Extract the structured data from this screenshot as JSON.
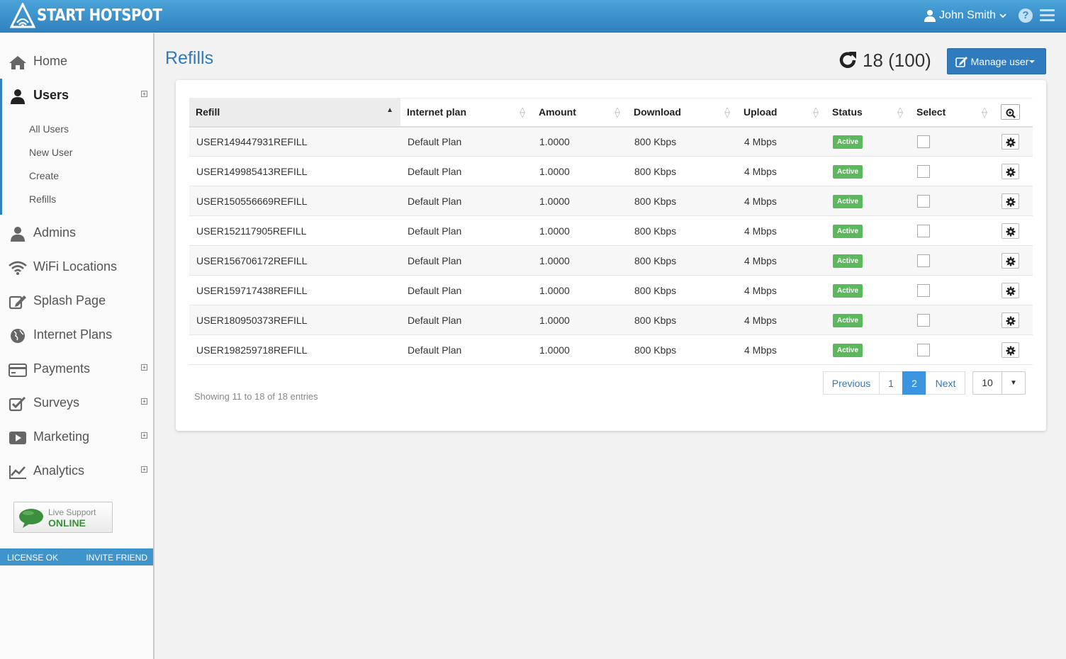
{
  "header": {
    "brand": "START HOTSPOT",
    "user_name": "John Smith",
    "help_glyph": "?"
  },
  "sidebar": {
    "items": [
      {
        "label": "Home",
        "icon": "home-icon"
      },
      {
        "label": "Users",
        "icon": "user-icon",
        "active": true,
        "expandable": true
      },
      {
        "label": "Admins",
        "icon": "admins-icon"
      },
      {
        "label": "WiFi Locations",
        "icon": "wifi-icon"
      },
      {
        "label": "Splash Page",
        "icon": "edit-icon"
      },
      {
        "label": "Internet Plans",
        "icon": "globe-icon"
      },
      {
        "label": "Payments",
        "icon": "credit-card-icon",
        "expandable": true
      },
      {
        "label": "Surveys",
        "icon": "check-square-icon",
        "expandable": true
      },
      {
        "label": "Marketing",
        "icon": "play-icon",
        "expandable": true
      },
      {
        "label": "Analytics",
        "icon": "chart-icon",
        "expandable": true
      }
    ],
    "sub_items": [
      "All Users",
      "New User",
      "Create",
      "Refills"
    ],
    "live_support": {
      "line1": "Live Support",
      "line2": "ONLINE"
    },
    "license": "LICENSE OK",
    "invite": "INVITE FRIEND"
  },
  "main": {
    "title": "Refills",
    "refill_count": "18 (100)",
    "manage_label": "Manage user"
  },
  "table": {
    "columns": [
      "Refill",
      "Internet plan",
      "Amount",
      "Download",
      "Upload",
      "Status",
      "Select"
    ],
    "rows": [
      {
        "refill": "USER149447931REFILL",
        "plan": "Default Plan",
        "amount": "1.0000",
        "download": "800 Kbps",
        "upload": "4 Mbps",
        "status": "Active"
      },
      {
        "refill": "USER149985413REFILL",
        "plan": "Default Plan",
        "amount": "1.0000",
        "download": "800 Kbps",
        "upload": "4 Mbps",
        "status": "Active"
      },
      {
        "refill": "USER150556669REFILL",
        "plan": "Default Plan",
        "amount": "1.0000",
        "download": "800 Kbps",
        "upload": "4 Mbps",
        "status": "Active"
      },
      {
        "refill": "USER152117905REFILL",
        "plan": "Default Plan",
        "amount": "1.0000",
        "download": "800 Kbps",
        "upload": "4 Mbps",
        "status": "Active"
      },
      {
        "refill": "USER156706172REFILL",
        "plan": "Default Plan",
        "amount": "1.0000",
        "download": "800 Kbps",
        "upload": "4 Mbps",
        "status": "Active"
      },
      {
        "refill": "USER159717438REFILL",
        "plan": "Default Plan",
        "amount": "1.0000",
        "download": "800 Kbps",
        "upload": "4 Mbps",
        "status": "Active"
      },
      {
        "refill": "USER180950373REFILL",
        "plan": "Default Plan",
        "amount": "1.0000",
        "download": "800 Kbps",
        "upload": "4 Mbps",
        "status": "Active"
      },
      {
        "refill": "USER198259718REFILL",
        "plan": "Default Plan",
        "amount": "1.0000",
        "download": "800 Kbps",
        "upload": "4 Mbps",
        "status": "Active"
      }
    ],
    "showing": "Showing 11 to 18 of 18 entries",
    "pager": {
      "previous": "Previous",
      "pages": [
        "1",
        "2"
      ],
      "current": "2",
      "next": "Next"
    },
    "per_page": "10"
  },
  "colors": {
    "header": "#3a93cf",
    "accent": "#2f7bbd",
    "active_badge": "#5cb85c",
    "current_page": "#3b94e0"
  }
}
